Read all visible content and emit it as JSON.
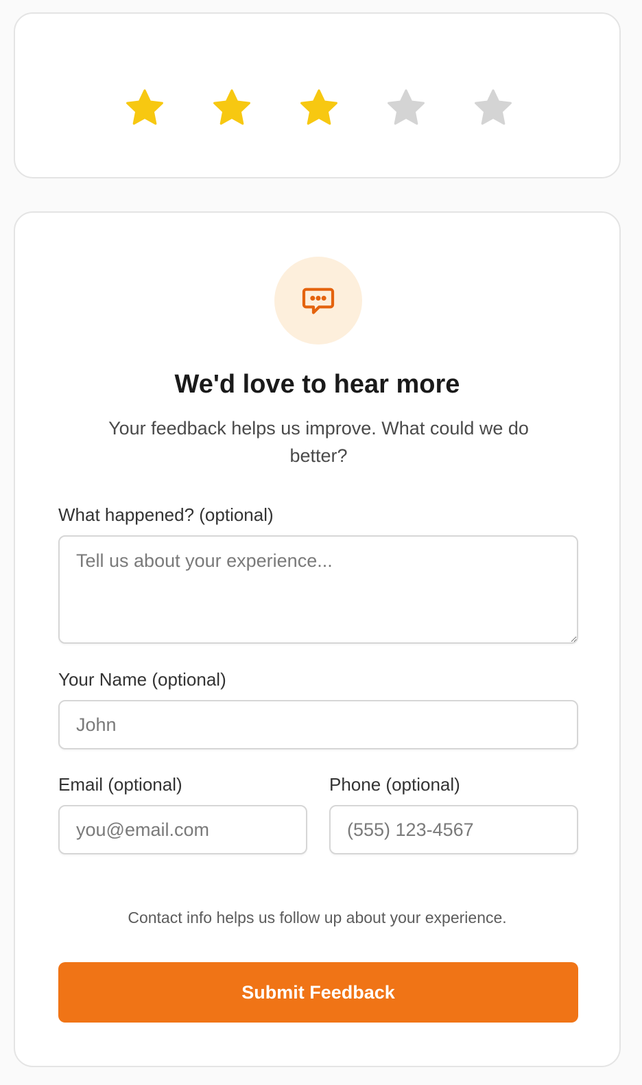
{
  "rating": {
    "value": 3,
    "max": 5,
    "stars": [
      {
        "filled": true
      },
      {
        "filled": true
      },
      {
        "filled": true
      },
      {
        "filled": false
      },
      {
        "filled": false
      }
    ],
    "filled_color": "#f7c811",
    "empty_color": "#d4d4d4"
  },
  "feedback": {
    "icon": "message-dots-icon",
    "icon_color": "#e4630e",
    "icon_bg": "#fdefdc",
    "heading": "We'd love to hear more",
    "subtitle": "Your feedback helps us improve. What could we do better?",
    "what_happened": {
      "label": "What happened? (optional)",
      "placeholder": "Tell us about your experience..."
    },
    "name": {
      "label": "Your Name (optional)",
      "placeholder": "John"
    },
    "email": {
      "label": "Email (optional)",
      "placeholder": "you@email.com"
    },
    "phone": {
      "label": "Phone (optional)",
      "placeholder": "(555) 123-4567"
    },
    "helper_text": "Contact info helps us follow up about your experience.",
    "submit_label": "Submit Feedback",
    "accent_color": "#f07416"
  }
}
